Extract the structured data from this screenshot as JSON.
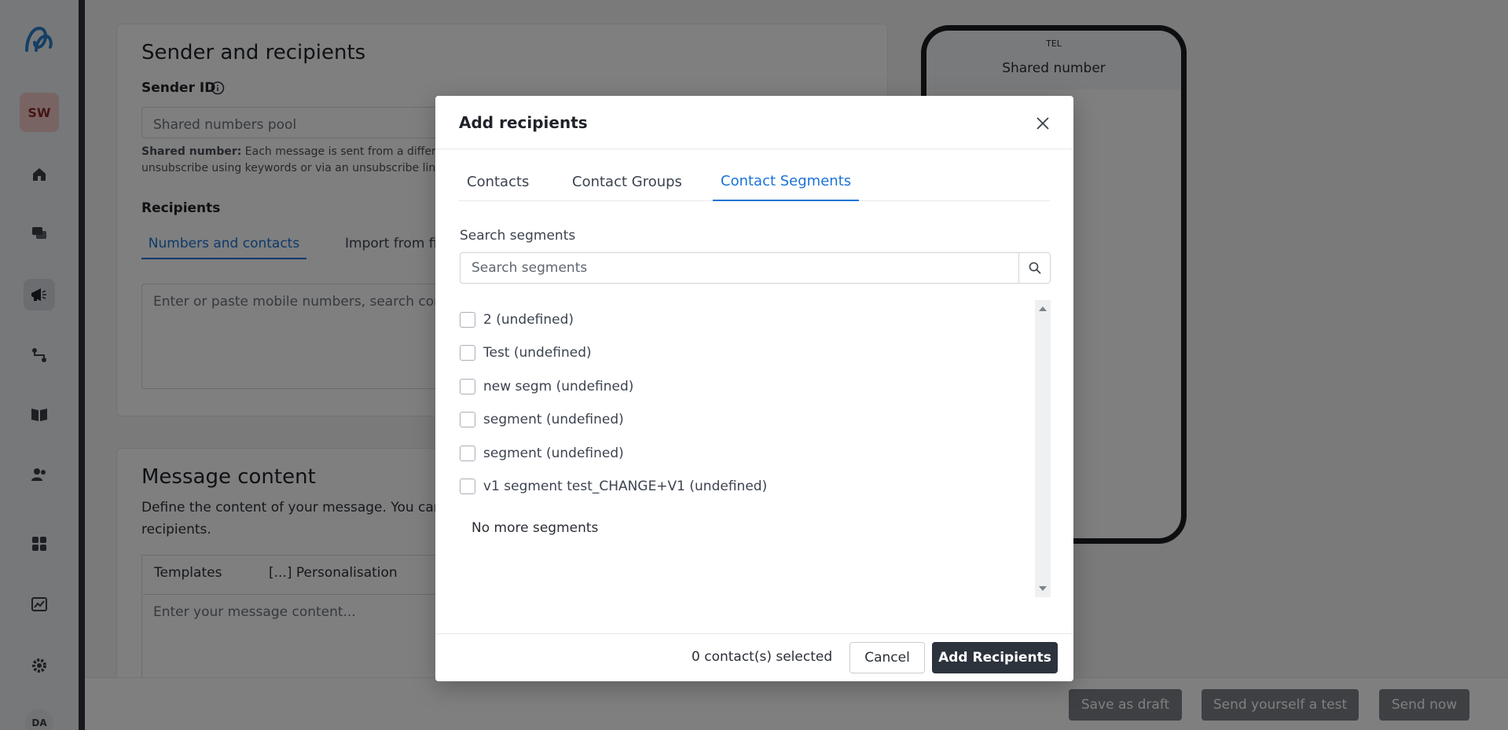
{
  "sidebar": {
    "user_initials": "SW",
    "bottom_user_initials": "DA",
    "icons": [
      "home-icon",
      "chat-icon",
      "megaphone-icon",
      "workflow-icon",
      "book-icon",
      "contacts-icon",
      "apps-icon",
      "analytics-icon",
      "gear-icon"
    ]
  },
  "background": {
    "sender_section": {
      "title": "Sender and recipients",
      "sender_id_label": "Sender ID",
      "sender_id_value": "Shared numbers pool",
      "note_bold": "Shared number:",
      "note_text_line1": " Each message is sent from a differen",
      "note_text_line2": "unsubscribe using keywords or via an unsubscribe link",
      "recipients_label": "Recipients",
      "tabs": [
        "Numbers and contacts",
        "Import from fil"
      ],
      "recipients_placeholder": "Enter or paste mobile numbers, search conta"
    },
    "message_section": {
      "title": "Message content",
      "description_line1": "Define the content of your message. You can u",
      "description_line2": "recipients.",
      "toolbar_templates": "Templates",
      "toolbar_personalisation": "[...] Personalisation",
      "message_placeholder": "Enter your message content..."
    },
    "phone_preview": {
      "carrier": "TEL",
      "header": "Shared number"
    },
    "footer": {
      "save_draft": "Save as draft",
      "send_test": "Send yourself a test",
      "send_now": "Send now"
    }
  },
  "modal": {
    "title": "Add recipients",
    "tabs": [
      {
        "label": "Contacts",
        "active": false
      },
      {
        "label": "Contact Groups",
        "active": false
      },
      {
        "label": "Contact Segments",
        "active": true
      }
    ],
    "search": {
      "label": "Search segments",
      "placeholder": "Search segments"
    },
    "segments": [
      "2 (undefined)",
      "Test (undefined)",
      "new segm (undefined)",
      "segment (undefined)",
      "segment (undefined)",
      "v1 segment test_CHANGE+V1 (undefined)"
    ],
    "no_more_text": "No more segments",
    "footer": {
      "selected_count": "0 contact(s) selected",
      "cancel": "Cancel",
      "add": "Add Recipients"
    }
  },
  "colors": {
    "accent": "#1a73d6",
    "primary_button": "#2d333c"
  }
}
